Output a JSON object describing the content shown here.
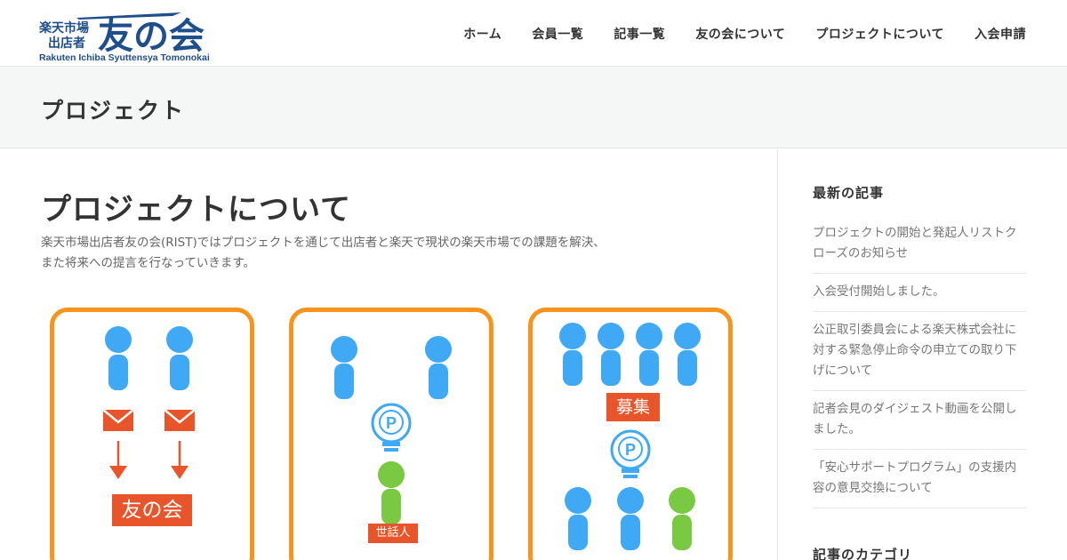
{
  "brand": {
    "logo_text_small": [
      "楽天市場",
      "出店者"
    ],
    "logo_text_big": "友の会",
    "logo_subtitle": "Rakuten Ichiba Syuttensya Tomonokai",
    "logo_color": "#1f4e8c"
  },
  "nav": {
    "items": [
      "ホーム",
      "会員一覧",
      "記事一覧",
      "友の会について",
      "プロジェクトについて",
      "入会申請"
    ]
  },
  "page_title": "プロジェクト",
  "main": {
    "heading": "プロジェクトについて",
    "intro_lines": [
      "楽天市場出店者友の会(RIST)ではプロジェクトを通じて出店者と楽天で現状の楽天市場での課題を解決、",
      "また将来への提言を行なっていきます。"
    ],
    "panels": [
      {
        "label": "友の会"
      },
      {
        "label": "世話人"
      },
      {
        "label": "募集"
      }
    ]
  },
  "sidebar": {
    "recent_heading": "最新の記事",
    "recent_posts": [
      "プロジェクトの開始と発起人リストクローズのお知らせ",
      "入会受付開始しました。",
      "公正取引委員会による楽天株式会社に対する緊急停止命令の申立ての取り下げについて",
      "記者会見のダイジェスト動画を公開しました。",
      "「安心サポートプログラム」の支援内容の意見交換について"
    ],
    "categories_heading": "記事のカテゴリ"
  },
  "colors": {
    "accent_orange": "#f7941d",
    "tag_red": "#e8552b",
    "person_blue": "#3fa9f5",
    "person_green": "#7ac943"
  },
  "icons": [
    "envelope-icon",
    "arrow-down-icon",
    "lightbulb-icon",
    "person-icon"
  ]
}
